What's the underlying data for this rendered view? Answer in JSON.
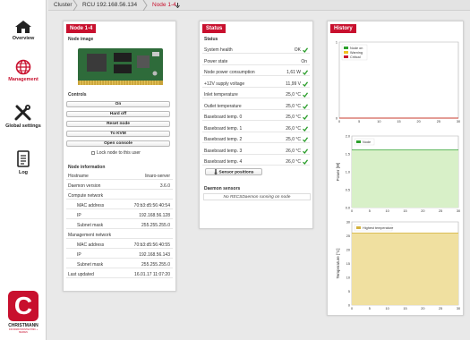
{
  "breadcrumb": [
    "Cluster",
    "RCU 192.168.56.134",
    "Node 1-4"
  ],
  "sidebar": {
    "items": [
      {
        "label": "Overview",
        "icon": "home-icon"
      },
      {
        "label": "Management",
        "icon": "globe-icon"
      },
      {
        "label": "Global settings",
        "icon": "wrench-screwdriver-icon"
      },
      {
        "label": "Log",
        "icon": "document-icon"
      }
    ],
    "logo": {
      "letter": "C",
      "name": "CHRISTMANN",
      "tagline": "INFORMATIONSTECHNIK + MEDIEN"
    }
  },
  "node": {
    "title": "Node 1-4",
    "image_label": "Node image",
    "controls_label": "Controls",
    "buttons": [
      "On",
      "Hard off",
      "Reset node",
      "To KVM",
      "Open console"
    ],
    "lock_label": "Lock node to this user",
    "info_label": "Node information",
    "info": [
      {
        "k": "Hostname",
        "v": "linaro-server",
        "indent": false
      },
      {
        "k": "Daemon version",
        "v": "3.6.0",
        "indent": false
      },
      {
        "k": "Compute network",
        "v": "",
        "indent": false
      },
      {
        "k": "MAC address",
        "v": "70:b3:d5:56:40:54",
        "indent": true
      },
      {
        "k": "IP",
        "v": "192.168.56.128",
        "indent": true
      },
      {
        "k": "Subnet mask",
        "v": "255.255.255.0",
        "indent": true
      },
      {
        "k": "Management network",
        "v": "",
        "indent": false
      },
      {
        "k": "MAC address",
        "v": "70:b3:d5:56:40:55",
        "indent": true
      },
      {
        "k": "IP",
        "v": "192.168.56.143",
        "indent": true
      },
      {
        "k": "Subnet mask",
        "v": "255.255.255.0",
        "indent": true
      },
      {
        "k": "Last updated",
        "v": "16.01.17 11:07:20",
        "indent": false
      }
    ]
  },
  "status": {
    "title": "Status",
    "section_label": "Status",
    "rows": [
      {
        "k": "System health",
        "v": "OK",
        "check": true
      },
      {
        "k": "Power state",
        "v": "On",
        "check": false
      },
      {
        "k": "Node power consumption",
        "v": "1,61 W",
        "check": true
      },
      {
        "k": "+12V supply voltage",
        "v": "11,99 V",
        "check": true
      },
      {
        "k": "Inlet temperature",
        "v": "25,0 °C",
        "check": true
      },
      {
        "k": "Outlet temperature",
        "v": "25,0 °C",
        "check": true
      },
      {
        "k": "Baseboard temp. 0",
        "v": "25,0 °C",
        "check": true
      },
      {
        "k": "Baseboard temp. 1",
        "v": "26,0 °C",
        "check": true
      },
      {
        "k": "Baseboard temp. 2",
        "v": "25,0 °C",
        "check": true
      },
      {
        "k": "Baseboard temp. 3",
        "v": "26,0 °C",
        "check": true
      },
      {
        "k": "Baseboard temp. 4",
        "v": "26,0 °C",
        "check": true
      }
    ],
    "sensor_button": "Sensor positions",
    "daemon_label": "Daemon sensors",
    "daemon_text": "No RECSDaemon running on node"
  },
  "history": {
    "title": "History",
    "colors": {
      "node_on": "#2ca02c",
      "warning": "#f0c020",
      "critical": "#c8102e",
      "node_fill": "#d8f0c8",
      "temp_fill": "#f0e0a0"
    }
  },
  "chart_data": [
    {
      "type": "area",
      "series": [
        {
          "name": "Node on",
          "values": [
            0,
            0,
            0,
            0,
            0,
            0,
            0
          ]
        },
        {
          "name": "Warning",
          "values": [
            0,
            0,
            0,
            0,
            0,
            0,
            0
          ]
        },
        {
          "name": "Critical",
          "values": [
            0,
            0,
            0,
            0,
            0,
            0,
            0
          ]
        }
      ],
      "x": [
        0,
        5,
        10,
        15,
        20,
        25,
        30
      ],
      "xticks": [
        "0",
        "5",
        "10",
        "15",
        "20",
        "25",
        "30"
      ],
      "yticks": [
        "0",
        "1"
      ],
      "ylim": [
        0,
        1
      ],
      "legend": "top-left"
    },
    {
      "type": "area",
      "series": [
        {
          "name": "Node",
          "values": [
            1.61,
            1.61,
            1.61,
            1.61,
            1.61,
            1.61,
            1.61
          ]
        }
      ],
      "x": [
        0,
        5,
        10,
        15,
        20,
        25,
        30
      ],
      "xticks": [
        "0",
        "5",
        "10",
        "15",
        "20",
        "25",
        "30"
      ],
      "yticks": [
        "0.0",
        "0.5",
        "1.0",
        "1.5",
        "2.0"
      ],
      "ylim": [
        0,
        2
      ],
      "ylabel": "Power [W]",
      "legend": "top-left"
    },
    {
      "type": "area",
      "series": [
        {
          "name": "Highest temperature",
          "values": [
            26,
            26,
            26,
            26,
            26,
            26,
            26
          ]
        }
      ],
      "x": [
        0,
        5,
        10,
        15,
        20,
        25,
        30
      ],
      "xticks": [
        "0",
        "5",
        "10",
        "15",
        "20",
        "25",
        "30"
      ],
      "yticks": [
        "0",
        "5",
        "10",
        "15",
        "20",
        "25",
        "30"
      ],
      "ylim": [
        0,
        30
      ],
      "ylabel": "Temperature [°C]",
      "legend": "top-left"
    }
  ]
}
